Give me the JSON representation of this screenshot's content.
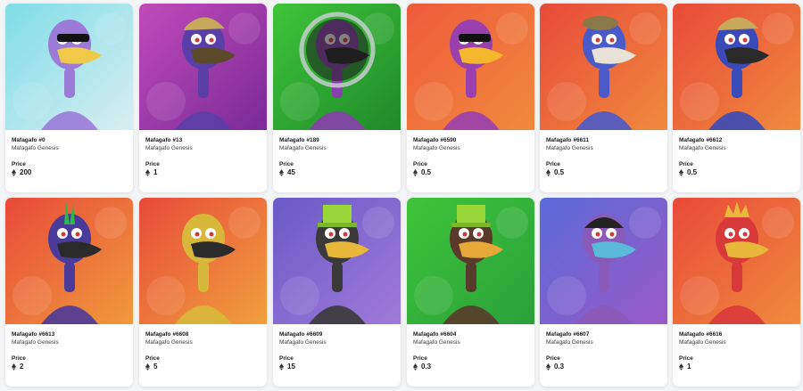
{
  "price_label": "Price",
  "currency_icon": "ethereum-icon",
  "nfts": [
    {
      "name": "Mafagafo #0",
      "collection": "Mafagafo Genesis",
      "price": "200",
      "bg": [
        "#7fdde8",
        "#d8eef0"
      ],
      "body": "#9b7ad8",
      "beak": "#f0c94a",
      "accessory": "sunglasses"
    },
    {
      "name": "Mafagafo #13",
      "collection": "Mafagafo Genesis",
      "price": "1",
      "bg": [
        "#c04bb8",
        "#7a2a9a"
      ],
      "body": "#5a3fa8",
      "beak": "#5b4a2a",
      "accessory": "cap"
    },
    {
      "name": "Mafagafo #189",
      "collection": "Mafagafo Genesis",
      "price": "45",
      "bg": [
        "#3ec43a",
        "#1f8a2a"
      ],
      "body": "#8a3fae",
      "beak": "#222222",
      "accessory": "helmet"
    },
    {
      "name": "Mafagafo #6590",
      "collection": "Mafagafo Genesis",
      "price": "0.5",
      "bg": [
        "#ef5a3c",
        "#f08a3c"
      ],
      "body": "#9a3fae",
      "beak": "#f4b72e",
      "accessory": "sunglasses"
    },
    {
      "name": "Mafagafo #6611",
      "collection": "Mafagafo Genesis",
      "price": "0.5",
      "bg": [
        "#e84a3a",
        "#f08a3c"
      ],
      "body": "#4a5ac8",
      "beak": "#e9e2d6",
      "accessory": "beret"
    },
    {
      "name": "Mafagafo #6612",
      "collection": "Mafagafo Genesis",
      "price": "0.5",
      "bg": [
        "#e84a3a",
        "#f08a3c"
      ],
      "body": "#3a4ab8",
      "beak": "#2a2a2a",
      "accessory": "cap"
    },
    {
      "name": "Mafagafo #6613",
      "collection": "Mafagafo Genesis",
      "price": "2",
      "bg": [
        "#e84a3a",
        "#f09a3c"
      ],
      "body": "#4a3a9a",
      "beak": "#2a2a2a",
      "accessory": "mohawk"
    },
    {
      "name": "Mafagafo #6608",
      "collection": "Mafagafo Genesis",
      "price": "5",
      "bg": [
        "#e84a3a",
        "#f0a03c"
      ],
      "body": "#d8b83a",
      "beak": "#2a2a2a",
      "accessory": "none"
    },
    {
      "name": "Mafagafo #6609",
      "collection": "Mafagafo Genesis",
      "price": "15",
      "bg": [
        "#6a5ac8",
        "#a07ad8"
      ],
      "body": "#3a3a3a",
      "beak": "#e8b83a",
      "accessory": "tophat"
    },
    {
      "name": "Mafagafo #6604",
      "collection": "Mafagafo Genesis",
      "price": "0.3",
      "bg": [
        "#3ec43a",
        "#2aa03a"
      ],
      "body": "#5a3a2a",
      "beak": "#e8a83a",
      "accessory": "tophat"
    },
    {
      "name": "Mafagafo #6607",
      "collection": "Mafagafo Genesis",
      "price": "0.3",
      "bg": [
        "#5a6ad8",
        "#9a5ac8"
      ],
      "body": "#8a5ab8",
      "beak": "#5ab8d8",
      "accessory": "beanie"
    },
    {
      "name": "Mafagafo #6616",
      "collection": "Mafagafo Genesis",
      "price": "1",
      "bg": [
        "#e84a3a",
        "#f08a3c"
      ],
      "body": "#d83a3a",
      "beak": "#e8b83a",
      "accessory": "crown"
    }
  ]
}
